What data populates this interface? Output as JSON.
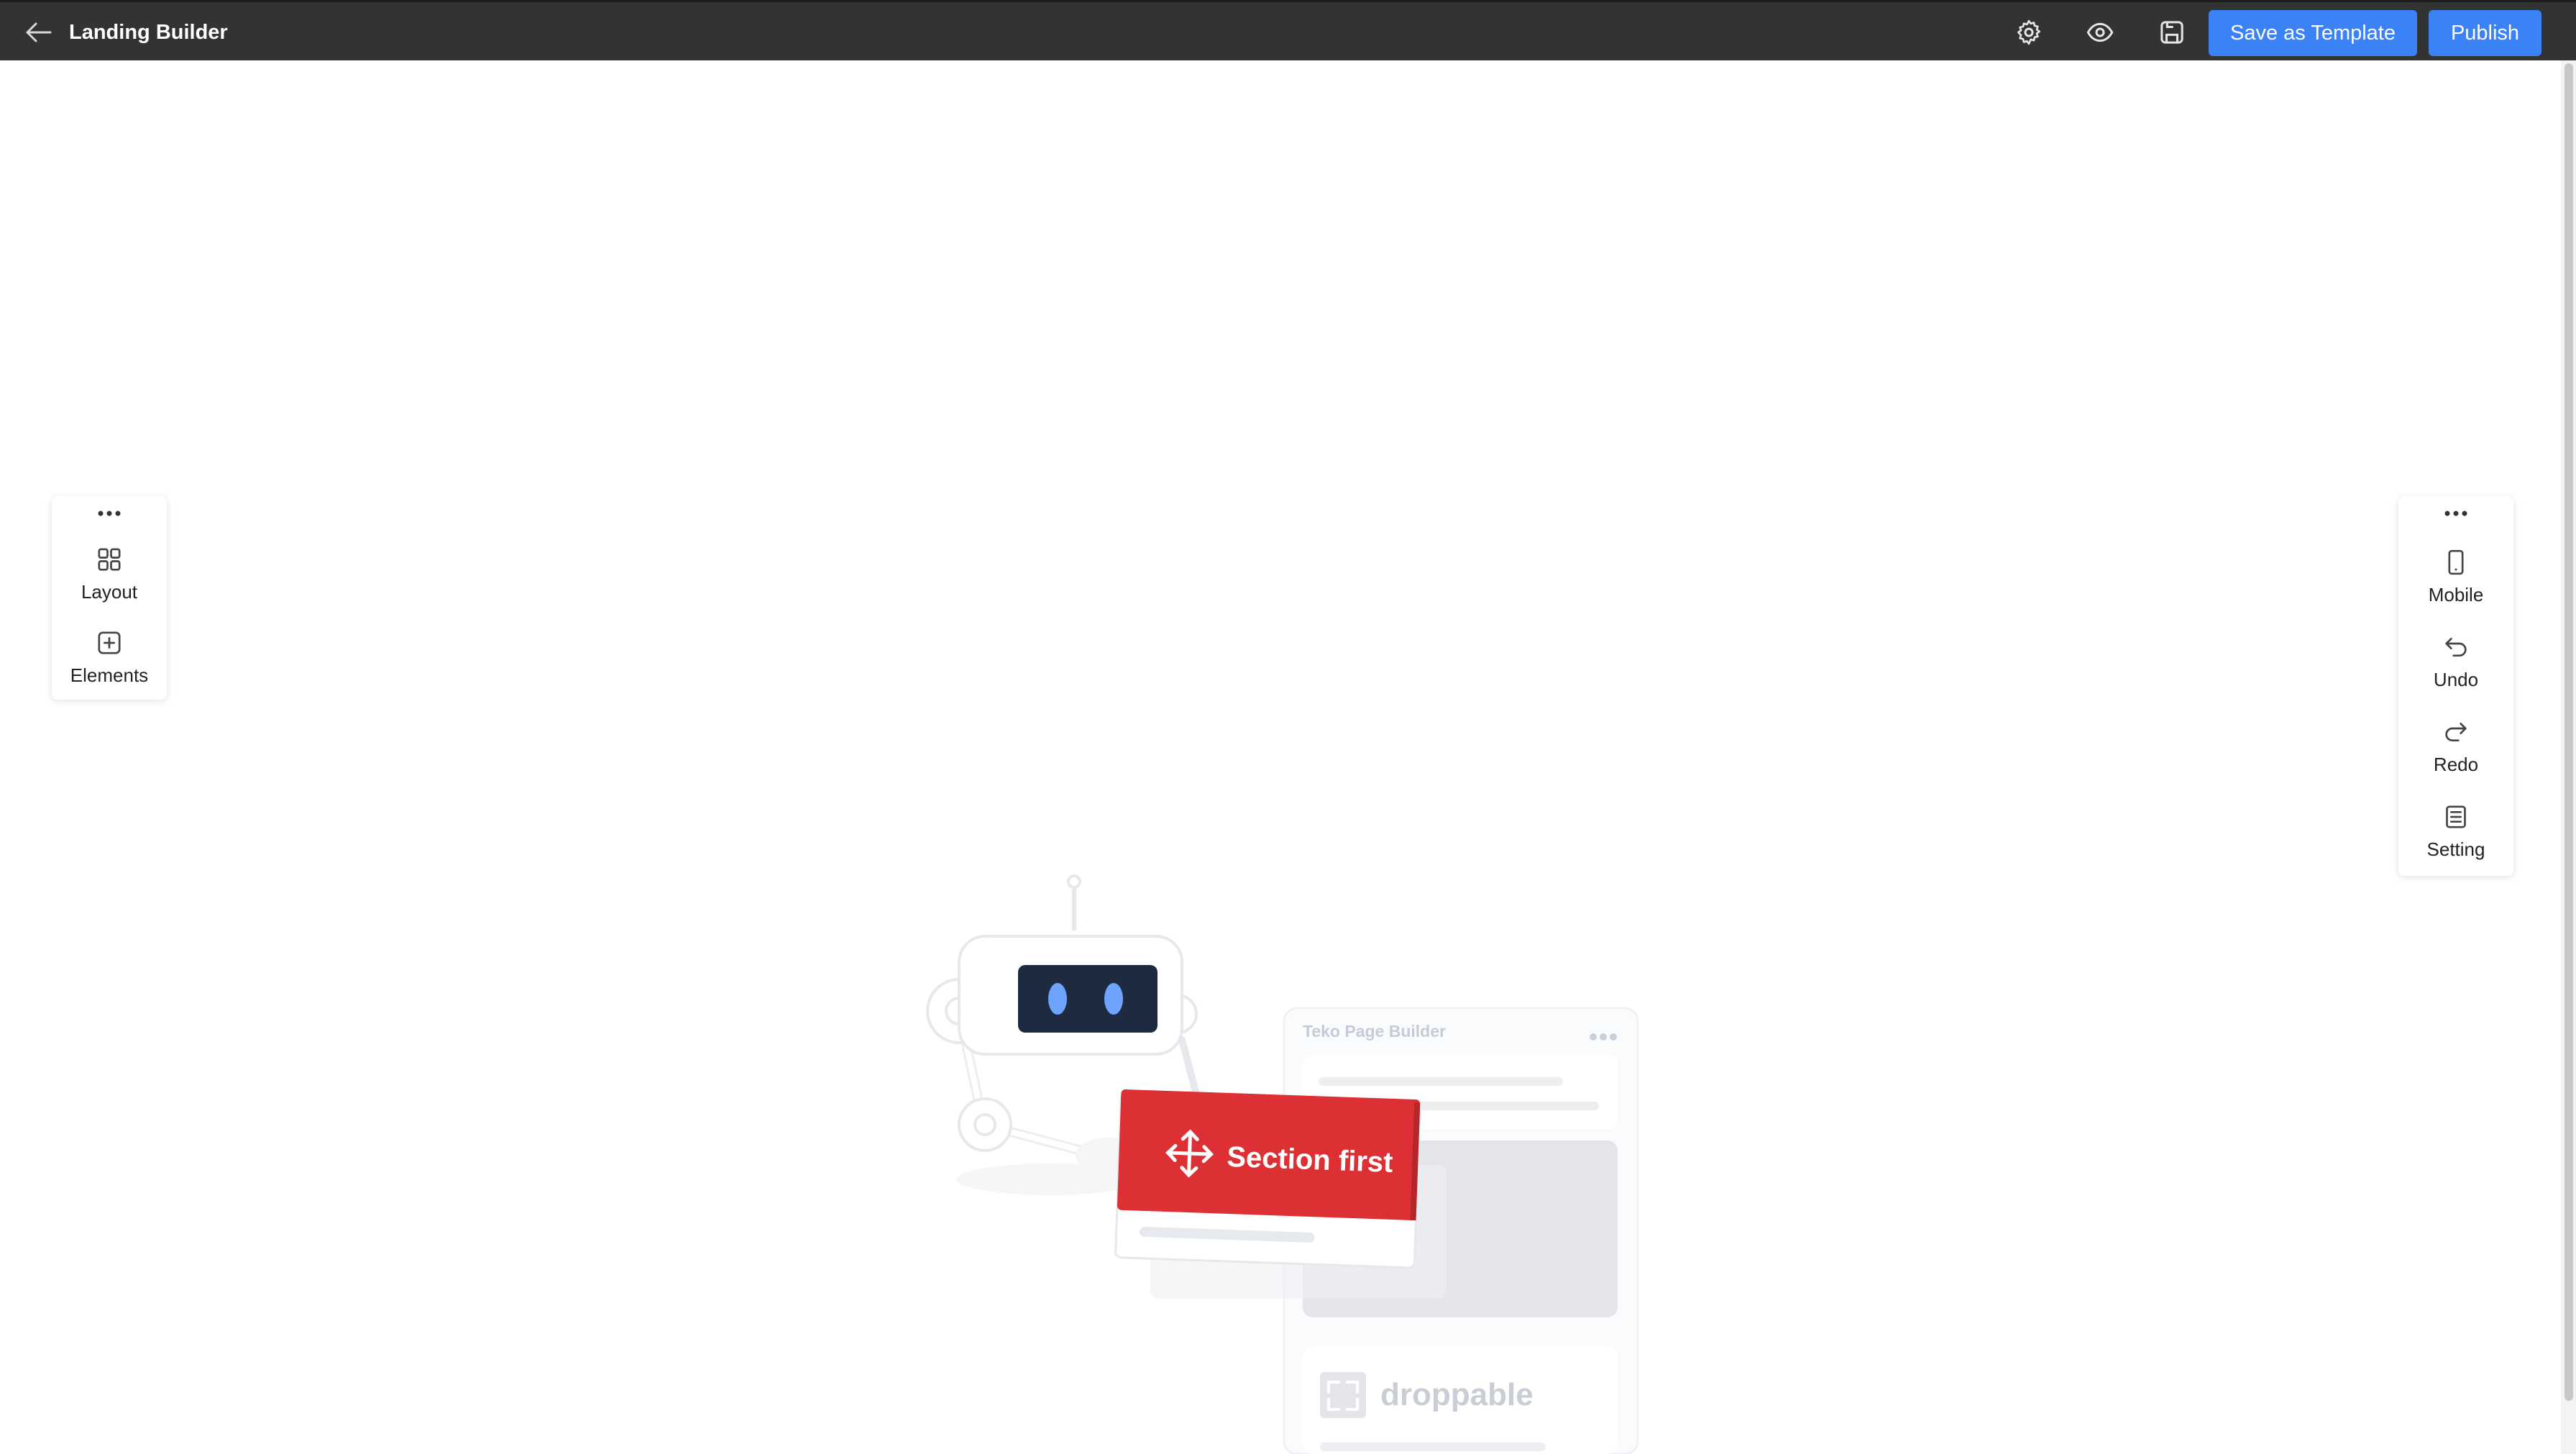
{
  "header": {
    "title": "Landing Builder",
    "back_icon": "arrow-left-icon",
    "settings_icon": "gear-icon",
    "preview_icon": "eye-icon",
    "save_icon": "save-icon",
    "save_template_label": "Save as Template",
    "publish_label": "Publish"
  },
  "left_toolbar": {
    "menu_icon": "more-horizontal-icon",
    "items": [
      {
        "label": "Layout",
        "icon": "grid-icon"
      },
      {
        "label": "Elements",
        "icon": "plus-square-icon"
      }
    ]
  },
  "right_toolbar": {
    "menu_icon": "more-horizontal-icon",
    "items": [
      {
        "label": "Mobile",
        "icon": "mobile-icon"
      },
      {
        "label": "Undo",
        "icon": "undo-icon"
      },
      {
        "label": "Redo",
        "icon": "redo-icon"
      },
      {
        "label": "Setting",
        "icon": "list-icon"
      }
    ]
  },
  "empty_state": {
    "brand_text": "Teko Page Builder",
    "section_card_label": "Section first",
    "droppable_label": "droppable"
  },
  "colors": {
    "topbar_bg": "#333333",
    "primary": "#3b82f6",
    "section_red": "#dc3035"
  }
}
